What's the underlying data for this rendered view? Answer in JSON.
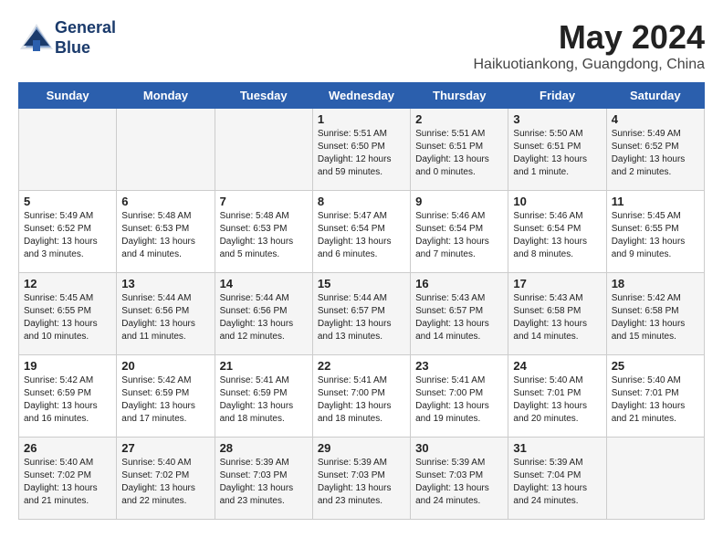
{
  "header": {
    "logo_line1": "General",
    "logo_line2": "Blue",
    "month_year": "May 2024",
    "location": "Haikuotiankong, Guangdong, China"
  },
  "days_of_week": [
    "Sunday",
    "Monday",
    "Tuesday",
    "Wednesday",
    "Thursday",
    "Friday",
    "Saturday"
  ],
  "weeks": [
    [
      {
        "day": "",
        "sunrise": "",
        "sunset": "",
        "daylight": ""
      },
      {
        "day": "",
        "sunrise": "",
        "sunset": "",
        "daylight": ""
      },
      {
        "day": "",
        "sunrise": "",
        "sunset": "",
        "daylight": ""
      },
      {
        "day": "1",
        "sunrise": "Sunrise: 5:51 AM",
        "sunset": "Sunset: 6:50 PM",
        "daylight": "Daylight: 12 hours and 59 minutes."
      },
      {
        "day": "2",
        "sunrise": "Sunrise: 5:51 AM",
        "sunset": "Sunset: 6:51 PM",
        "daylight": "Daylight: 13 hours and 0 minutes."
      },
      {
        "day": "3",
        "sunrise": "Sunrise: 5:50 AM",
        "sunset": "Sunset: 6:51 PM",
        "daylight": "Daylight: 13 hours and 1 minute."
      },
      {
        "day": "4",
        "sunrise": "Sunrise: 5:49 AM",
        "sunset": "Sunset: 6:52 PM",
        "daylight": "Daylight: 13 hours and 2 minutes."
      }
    ],
    [
      {
        "day": "5",
        "sunrise": "Sunrise: 5:49 AM",
        "sunset": "Sunset: 6:52 PM",
        "daylight": "Daylight: 13 hours and 3 minutes."
      },
      {
        "day": "6",
        "sunrise": "Sunrise: 5:48 AM",
        "sunset": "Sunset: 6:53 PM",
        "daylight": "Daylight: 13 hours and 4 minutes."
      },
      {
        "day": "7",
        "sunrise": "Sunrise: 5:48 AM",
        "sunset": "Sunset: 6:53 PM",
        "daylight": "Daylight: 13 hours and 5 minutes."
      },
      {
        "day": "8",
        "sunrise": "Sunrise: 5:47 AM",
        "sunset": "Sunset: 6:54 PM",
        "daylight": "Daylight: 13 hours and 6 minutes."
      },
      {
        "day": "9",
        "sunrise": "Sunrise: 5:46 AM",
        "sunset": "Sunset: 6:54 PM",
        "daylight": "Daylight: 13 hours and 7 minutes."
      },
      {
        "day": "10",
        "sunrise": "Sunrise: 5:46 AM",
        "sunset": "Sunset: 6:54 PM",
        "daylight": "Daylight: 13 hours and 8 minutes."
      },
      {
        "day": "11",
        "sunrise": "Sunrise: 5:45 AM",
        "sunset": "Sunset: 6:55 PM",
        "daylight": "Daylight: 13 hours and 9 minutes."
      }
    ],
    [
      {
        "day": "12",
        "sunrise": "Sunrise: 5:45 AM",
        "sunset": "Sunset: 6:55 PM",
        "daylight": "Daylight: 13 hours and 10 minutes."
      },
      {
        "day": "13",
        "sunrise": "Sunrise: 5:44 AM",
        "sunset": "Sunset: 6:56 PM",
        "daylight": "Daylight: 13 hours and 11 minutes."
      },
      {
        "day": "14",
        "sunrise": "Sunrise: 5:44 AM",
        "sunset": "Sunset: 6:56 PM",
        "daylight": "Daylight: 13 hours and 12 minutes."
      },
      {
        "day": "15",
        "sunrise": "Sunrise: 5:44 AM",
        "sunset": "Sunset: 6:57 PM",
        "daylight": "Daylight: 13 hours and 13 minutes."
      },
      {
        "day": "16",
        "sunrise": "Sunrise: 5:43 AM",
        "sunset": "Sunset: 6:57 PM",
        "daylight": "Daylight: 13 hours and 14 minutes."
      },
      {
        "day": "17",
        "sunrise": "Sunrise: 5:43 AM",
        "sunset": "Sunset: 6:58 PM",
        "daylight": "Daylight: 13 hours and 14 minutes."
      },
      {
        "day": "18",
        "sunrise": "Sunrise: 5:42 AM",
        "sunset": "Sunset: 6:58 PM",
        "daylight": "Daylight: 13 hours and 15 minutes."
      }
    ],
    [
      {
        "day": "19",
        "sunrise": "Sunrise: 5:42 AM",
        "sunset": "Sunset: 6:59 PM",
        "daylight": "Daylight: 13 hours and 16 minutes."
      },
      {
        "day": "20",
        "sunrise": "Sunrise: 5:42 AM",
        "sunset": "Sunset: 6:59 PM",
        "daylight": "Daylight: 13 hours and 17 minutes."
      },
      {
        "day": "21",
        "sunrise": "Sunrise: 5:41 AM",
        "sunset": "Sunset: 6:59 PM",
        "daylight": "Daylight: 13 hours and 18 minutes."
      },
      {
        "day": "22",
        "sunrise": "Sunrise: 5:41 AM",
        "sunset": "Sunset: 7:00 PM",
        "daylight": "Daylight: 13 hours and 18 minutes."
      },
      {
        "day": "23",
        "sunrise": "Sunrise: 5:41 AM",
        "sunset": "Sunset: 7:00 PM",
        "daylight": "Daylight: 13 hours and 19 minutes."
      },
      {
        "day": "24",
        "sunrise": "Sunrise: 5:40 AM",
        "sunset": "Sunset: 7:01 PM",
        "daylight": "Daylight: 13 hours and 20 minutes."
      },
      {
        "day": "25",
        "sunrise": "Sunrise: 5:40 AM",
        "sunset": "Sunset: 7:01 PM",
        "daylight": "Daylight: 13 hours and 21 minutes."
      }
    ],
    [
      {
        "day": "26",
        "sunrise": "Sunrise: 5:40 AM",
        "sunset": "Sunset: 7:02 PM",
        "daylight": "Daylight: 13 hours and 21 minutes."
      },
      {
        "day": "27",
        "sunrise": "Sunrise: 5:40 AM",
        "sunset": "Sunset: 7:02 PM",
        "daylight": "Daylight: 13 hours and 22 minutes."
      },
      {
        "day": "28",
        "sunrise": "Sunrise: 5:39 AM",
        "sunset": "Sunset: 7:03 PM",
        "daylight": "Daylight: 13 hours and 23 minutes."
      },
      {
        "day": "29",
        "sunrise": "Sunrise: 5:39 AM",
        "sunset": "Sunset: 7:03 PM",
        "daylight": "Daylight: 13 hours and 23 minutes."
      },
      {
        "day": "30",
        "sunrise": "Sunrise: 5:39 AM",
        "sunset": "Sunset: 7:03 PM",
        "daylight": "Daylight: 13 hours and 24 minutes."
      },
      {
        "day": "31",
        "sunrise": "Sunrise: 5:39 AM",
        "sunset": "Sunset: 7:04 PM",
        "daylight": "Daylight: 13 hours and 24 minutes."
      },
      {
        "day": "",
        "sunrise": "",
        "sunset": "",
        "daylight": ""
      }
    ]
  ]
}
